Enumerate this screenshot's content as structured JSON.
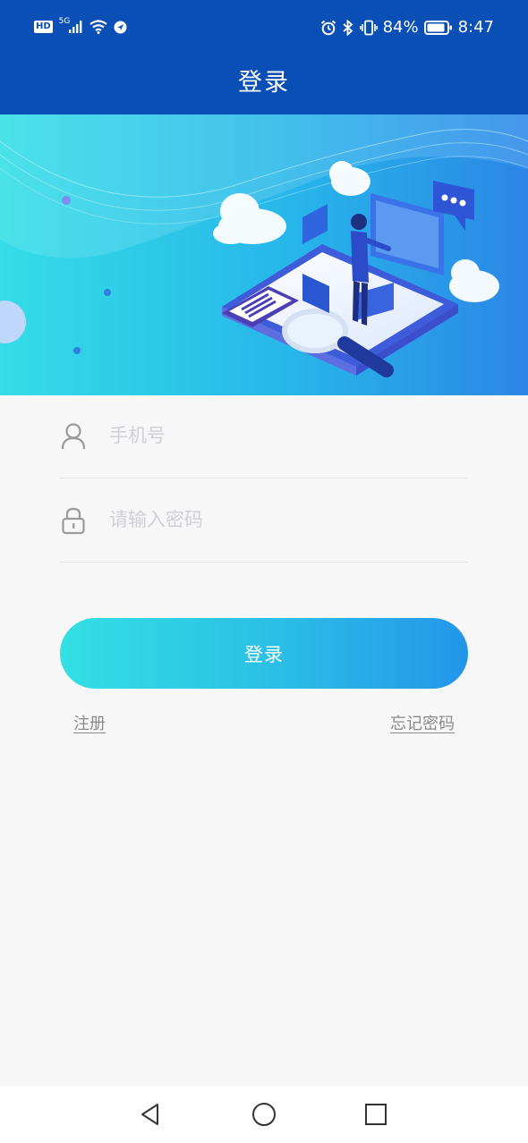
{
  "status_bar": {
    "network_badge": "HD",
    "network_type": "5G",
    "battery_percent": "84%",
    "time": "8:47",
    "left_icons": [
      "hd-icon",
      "signal-icon",
      "wifi-icon",
      "vpn-icon"
    ],
    "right_icons": [
      "alarm-icon",
      "bluetooth-icon",
      "vibrate-icon",
      "battery-icon"
    ]
  },
  "header": {
    "title": "登录",
    "background_color": "#0a4fb6"
  },
  "form": {
    "phone": {
      "placeholder": "手机号",
      "value": "",
      "icon": "user-icon"
    },
    "password": {
      "placeholder": "请输入密码",
      "value": "",
      "icon": "lock-icon"
    },
    "login_label": "登录",
    "register_label": "注册",
    "forgot_label": "忘记密码"
  },
  "nav_bar": {
    "buttons": [
      "back-icon",
      "home-icon",
      "recents-icon"
    ]
  },
  "colors": {
    "accent_start": "#33e0e3",
    "accent_end": "#2495ea",
    "page_background": "#f7f7f7"
  }
}
